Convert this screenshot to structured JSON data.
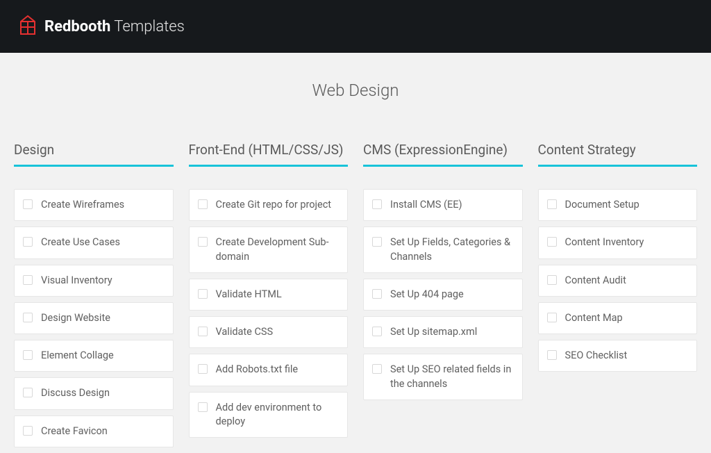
{
  "header": {
    "brand_bold": "Redbooth",
    "brand_light": " Templates"
  },
  "page_title": "Web Design",
  "columns": [
    {
      "title": "Design",
      "tasks": [
        "Create Wireframes",
        "Create Use Cases",
        "Visual Inventory",
        "Design Website",
        "Element Collage",
        "Discuss Design",
        "Create Favicon"
      ]
    },
    {
      "title": "Front-End (HTML/CSS/JS)",
      "tasks": [
        "Create Git repo for project",
        "Create Development Sub-domain",
        "Validate HTML",
        "Validate CSS",
        "Add Robots.txt file",
        "Add dev environment to deploy"
      ]
    },
    {
      "title": "CMS (ExpressionEngine)",
      "tasks": [
        "Install CMS (EE)",
        "Set Up Fields, Categories & Channels",
        "Set Up 404 page",
        "Set Up sitemap.xml",
        "Set Up SEO related fields in the channels"
      ]
    },
    {
      "title": "Content Strategy",
      "tasks": [
        "Document Setup",
        "Content Inventory",
        "Content Audit",
        "Content Map",
        "SEO Checklist"
      ]
    }
  ]
}
